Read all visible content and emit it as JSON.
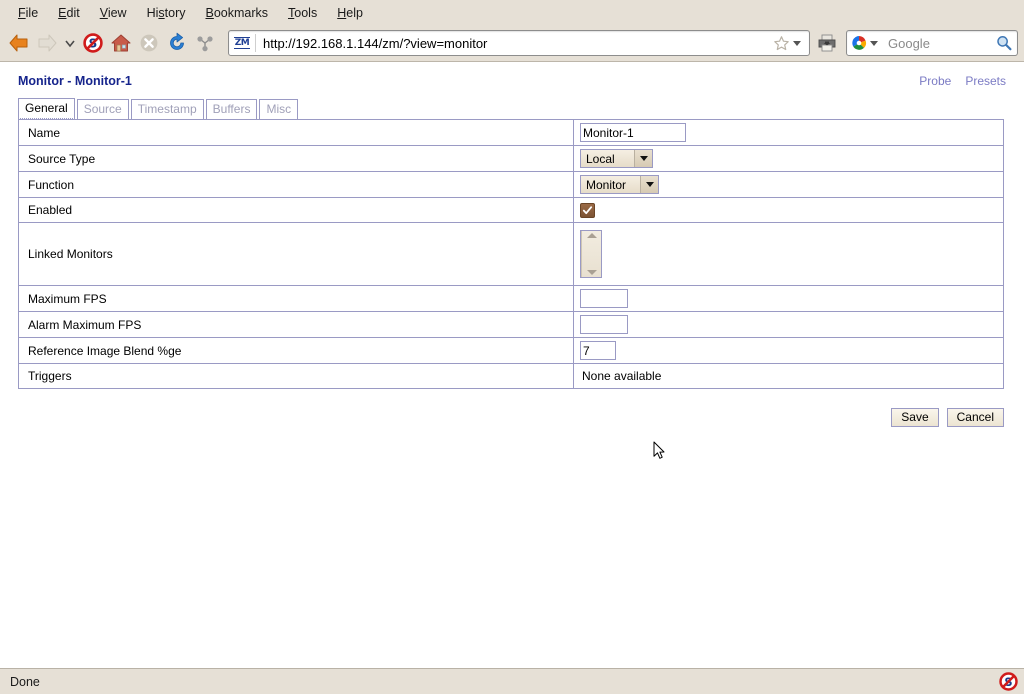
{
  "browser": {
    "menus": [
      {
        "name": "file",
        "label": "File",
        "accel": "F"
      },
      {
        "name": "edit",
        "label": "Edit",
        "accel": "E"
      },
      {
        "name": "view",
        "label": "View",
        "accel": "V"
      },
      {
        "name": "history",
        "label": "History",
        "accel": "s"
      },
      {
        "name": "bookmarks",
        "label": "Bookmarks",
        "accel": "B"
      },
      {
        "name": "tools",
        "label": "Tools",
        "accel": "T"
      },
      {
        "name": "help",
        "label": "Help",
        "accel": "H"
      }
    ],
    "toolbar": {
      "back_icon": "back-arrow-icon",
      "forward_icon": "forward-arrow-icon",
      "dropdown_icon": "chevron-down-icon",
      "noscript_icon": "noscript-icon",
      "home_icon": "home-icon",
      "stop_icon": "stop-icon",
      "reload_icon": "reload-icon",
      "molecule_icon": "molecule-icon",
      "print_icon": "printer-icon",
      "bookmark_star_icon": "star-icon"
    },
    "url": "http://192.168.1.144/zm/?view=monitor",
    "favicon_text": "ZM",
    "search": {
      "engine": "Google",
      "placeholder": "Google",
      "search_icon": "magnifier-icon"
    }
  },
  "page": {
    "title": "Monitor - Monitor-1",
    "links": [
      {
        "name": "probe",
        "label": "Probe"
      },
      {
        "name": "presets",
        "label": "Presets"
      }
    ],
    "tabs": [
      {
        "name": "general",
        "label": "General",
        "active": true
      },
      {
        "name": "source",
        "label": "Source",
        "active": false
      },
      {
        "name": "timestamp",
        "label": "Timestamp",
        "active": false
      },
      {
        "name": "buffers",
        "label": "Buffers",
        "active": false
      },
      {
        "name": "misc",
        "label": "Misc",
        "active": false
      }
    ],
    "fields": {
      "name": {
        "label": "Name",
        "value": "Monitor-1"
      },
      "source_type": {
        "label": "Source Type",
        "value": "Local"
      },
      "function": {
        "label": "Function",
        "value": "Monitor"
      },
      "enabled": {
        "label": "Enabled",
        "checked": true
      },
      "linked_monitors": {
        "label": "Linked Monitors",
        "value": ""
      },
      "maximum_fps": {
        "label": "Maximum FPS",
        "value": ""
      },
      "alarm_maximum_fps": {
        "label": "Alarm Maximum FPS",
        "value": ""
      },
      "reference_image_blend": {
        "label": "Reference Image Blend %ge",
        "value": "7"
      },
      "triggers": {
        "label": "Triggers",
        "value": "None available"
      }
    },
    "buttons": {
      "save": "Save",
      "cancel": "Cancel"
    }
  },
  "statusbar": {
    "text": "Done",
    "noscript_icon": "noscript-icon"
  },
  "colors": {
    "chrome_bg": "#e6e0d6",
    "title_blue": "#16248c",
    "link_blue": "#7b7bc4",
    "table_border": "#9a9ac4",
    "checkbox_brown": "#7d5334"
  }
}
